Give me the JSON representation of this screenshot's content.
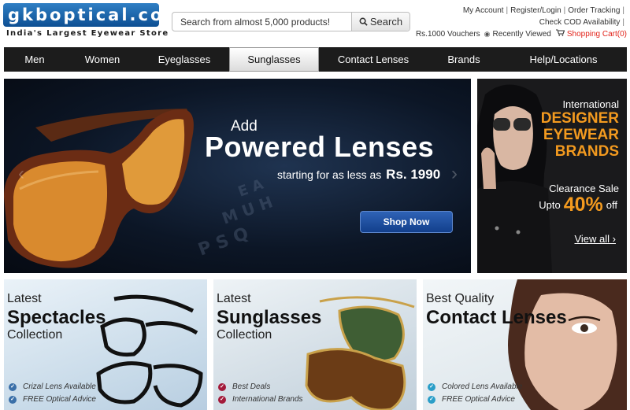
{
  "header": {
    "logo_text": "gkboptical.com",
    "logo_tagline": "India's Largest Eyewear Store",
    "search_placeholder": "Search from almost 5,000 products!",
    "search_button": "Search",
    "links": {
      "my_account": "My Account",
      "register_login": "Register/Login",
      "order_tracking": "Order Tracking",
      "cod": "Check COD Availability",
      "vouchers": "Rs.1000 Vouchers",
      "recently_viewed": "Recently Viewed",
      "cart": "Shopping Cart(0)"
    }
  },
  "nav": {
    "items": [
      {
        "label": "Men"
      },
      {
        "label": "Women"
      },
      {
        "label": "Eyeglasses"
      },
      {
        "label": "Sunglasses",
        "active": true
      },
      {
        "label": "Contact Lenses"
      },
      {
        "label": "Brands"
      },
      {
        "label": "Help/Locations"
      }
    ]
  },
  "hero": {
    "add": "Add",
    "title": "Powered Lenses",
    "subtitle": "starting for as less as",
    "price": "Rs. 1990",
    "button": "Shop Now"
  },
  "promo": {
    "line1": "International",
    "line2": "DESIGNER",
    "line3": "EYEWEAR",
    "line4": "BRANDS",
    "clearance": "Clearance Sale",
    "upto": "Upto",
    "percent": "40%",
    "off": "off",
    "view_all": "View all ›"
  },
  "tiles": [
    {
      "pre": "Latest",
      "big": "Spectacles",
      "post": "Collection",
      "items": [
        "Crizal Lens Available",
        "FREE Optical Advice"
      ]
    },
    {
      "pre": "Latest",
      "big": "Sunglasses",
      "post": "Collection",
      "items": [
        "Best Deals",
        "International Brands"
      ]
    },
    {
      "pre": "Best Quality",
      "big": "Contact Lenses",
      "post": "",
      "items": [
        "Colored Lens Available",
        "FREE Optical Advice"
      ]
    }
  ],
  "colors": {
    "nav_bg": "#1c1c1c",
    "accent_orange": "#f39a1f",
    "cart_red": "#e2231a",
    "logo_blue": "#0d4f93"
  }
}
